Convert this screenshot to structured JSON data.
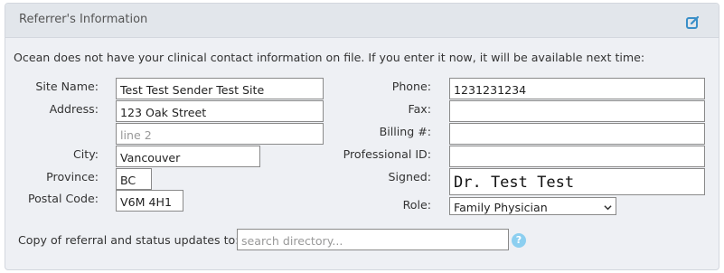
{
  "panel": {
    "title": "Referrer's Information",
    "edit_icon": "edit-icon",
    "intro": "Ocean does not have your clinical contact information on file. If you enter it now, it will be available next time:"
  },
  "left": {
    "site_name": {
      "label": "Site Name:",
      "value": "Test Test Sender Test Site"
    },
    "address": {
      "label": "Address:",
      "value": "123 Oak Street",
      "line2_placeholder": "line 2"
    },
    "city": {
      "label": "City:",
      "value": "Vancouver"
    },
    "province": {
      "label": "Province:",
      "value": "BC"
    },
    "postal_code": {
      "label": "Postal Code:",
      "value": "V6M 4H1"
    }
  },
  "right": {
    "phone": {
      "label": "Phone:",
      "value": "1231231234"
    },
    "fax": {
      "label": "Fax:",
      "value": ""
    },
    "billing": {
      "label": "Billing #:",
      "value": ""
    },
    "professional_id": {
      "label": "Professional ID:",
      "value": ""
    },
    "signed": {
      "label": "Signed:",
      "value": "Dr. Test Test"
    },
    "role": {
      "label": "Role:",
      "value": "Family Physician"
    }
  },
  "copy": {
    "label": "Copy of referral and status updates to:",
    "placeholder": "search directory...",
    "help_icon": "question-circle-icon",
    "help_glyph": "?"
  },
  "colors": {
    "accent": "#3a8fc8",
    "help": "#8ccff0",
    "panel_bg": "#eef0f4",
    "header_bg": "#e2e6eb"
  }
}
